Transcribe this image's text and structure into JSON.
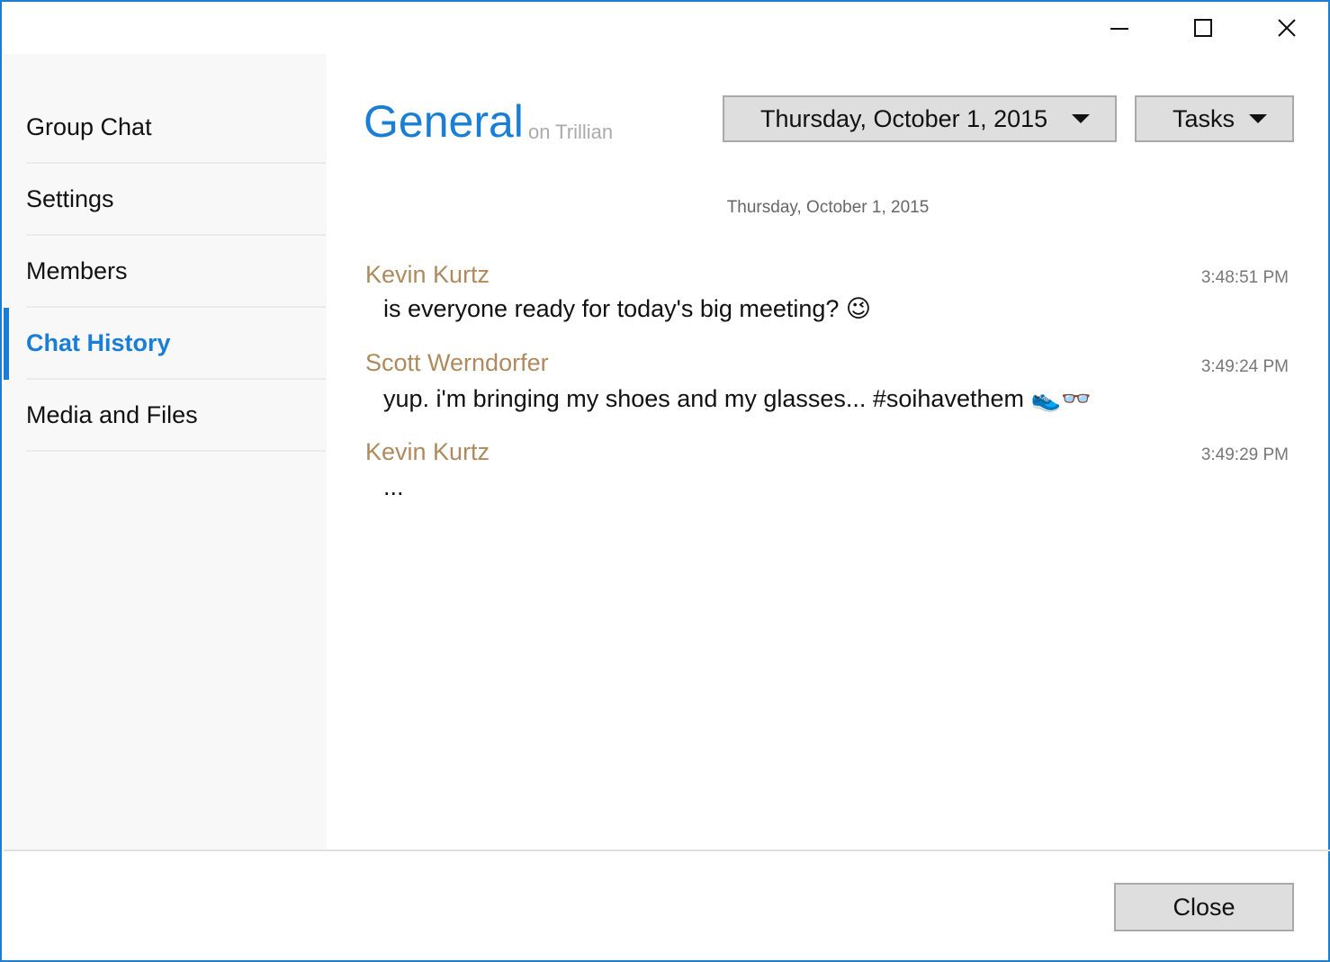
{
  "window": {
    "controls": {
      "minimize_icon": "minimize-icon",
      "maximize_icon": "maximize-icon",
      "close_icon": "close-icon"
    }
  },
  "sidebar": {
    "items": [
      {
        "label": "Group Chat",
        "active": false
      },
      {
        "label": "Settings",
        "active": false
      },
      {
        "label": "Members",
        "active": false
      },
      {
        "label": "Chat History",
        "active": true
      },
      {
        "label": "Media and Files",
        "active": false
      }
    ]
  },
  "header": {
    "title": "General",
    "subtitle": "on Trillian",
    "date_dropdown": {
      "value": "Thursday, October 1, 2015"
    },
    "tasks_dropdown": {
      "label": "Tasks"
    }
  },
  "history": {
    "date_separator": "Thursday, October 1, 2015",
    "messages": [
      {
        "author": "Kevin Kurtz",
        "time": "3:48:51 PM",
        "text": "is everyone ready for today's big meeting? 😉"
      },
      {
        "author": "Scott Werndorfer",
        "time": "3:49:24 PM",
        "text": "yup.  i'm bringing my shoes and my glasses... #soihavethem 👟👓"
      },
      {
        "author": "Kevin Kurtz",
        "time": "3:49:29 PM",
        "text": "..."
      }
    ]
  },
  "footer": {
    "close_label": "Close"
  },
  "colors": {
    "accent": "#1a7fd4",
    "author": "#ae8a5e",
    "sidebar_bg": "#f8f8f8",
    "button_bg": "#dedede"
  }
}
